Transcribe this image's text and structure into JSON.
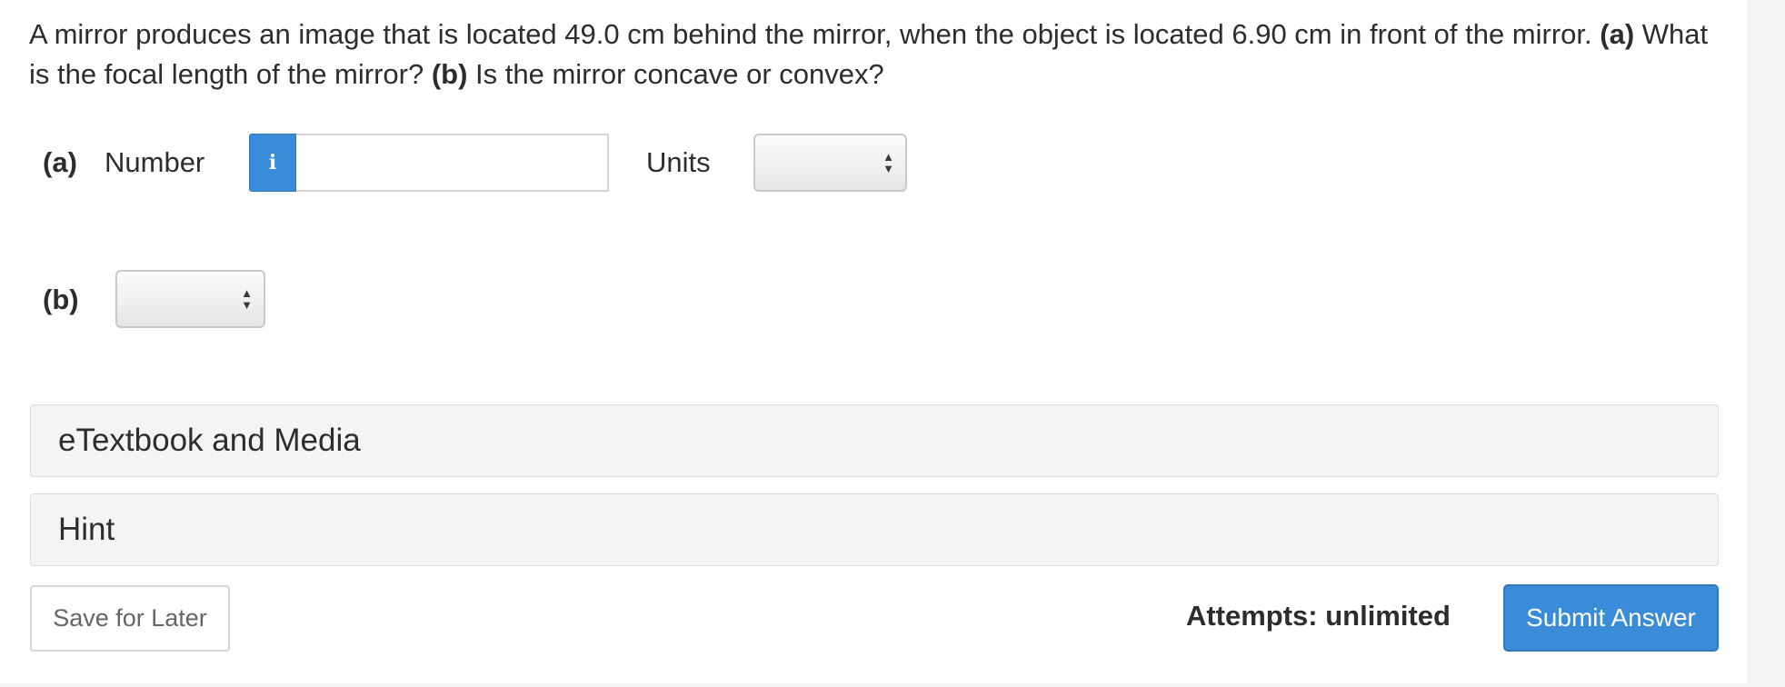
{
  "question": {
    "text_1": "A mirror produces an image that is located 49.0 cm behind the mirror, when the object is located 6.90 cm in front of the mirror. ",
    "part_a_marker": "(a)",
    "text_2": " What is the focal length of the mirror? ",
    "part_b_marker": "(b)",
    "text_3": " Is the mirror concave or convex?"
  },
  "part_a": {
    "label": "(a)",
    "number_label": "Number",
    "info_icon": "info-icon",
    "info_glyph": "i",
    "number_value": "",
    "units_label": "Units",
    "units_selected": ""
  },
  "part_b": {
    "label": "(b)",
    "selected": ""
  },
  "accordions": {
    "etextbook": "eTextbook and Media",
    "hint": "Hint"
  },
  "footer": {
    "save_label": "Save for Later",
    "attempts_label": "Attempts: unlimited",
    "submit_label": "Submit Answer"
  },
  "colors": {
    "accent": "#3a8bd8",
    "text": "#2d2d2d",
    "panel_bg": "#f4f4f4"
  }
}
